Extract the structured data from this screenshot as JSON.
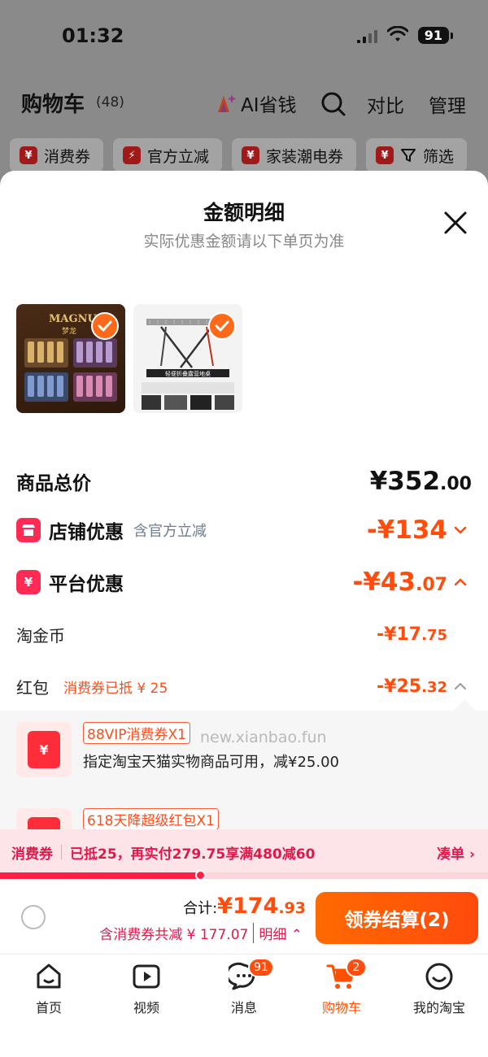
{
  "status": {
    "time": "01:32",
    "battery": "91"
  },
  "cart": {
    "title": "购物车",
    "count": "(48)",
    "ai_label": "AI省钱",
    "compare": "对比",
    "manage": "管理"
  },
  "filters": [
    {
      "label": "消费券",
      "icon": "coupon-icon"
    },
    {
      "label": "官方立减",
      "icon": "flash-icon"
    },
    {
      "label": "家装潮电券",
      "icon": "coupon-icon"
    },
    {
      "label": "筛选",
      "icon": "filter-icon"
    }
  ],
  "sheet": {
    "title": "金额明细",
    "subtitle": "实际优惠金额请以下单页为准",
    "thumb1_brand": "MAGNUM",
    "thumb1_brand_cn": "梦龙",
    "thumb2_caption": "轻便折叠露营地桌"
  },
  "rows": {
    "total_label": "商品总价",
    "total_int": "¥352",
    "total_dec": ".00",
    "shop_label": "店铺优惠",
    "shop_hint": "含官方立减",
    "shop_value": "-¥134",
    "platform_label": "平台优惠",
    "platform_int": "-¥43",
    "platform_dec": ".07",
    "coins_label": "淘金币",
    "coins_int": "-¥17",
    "coins_dec": ".75",
    "redpacket_label": "红包",
    "redpacket_hint": "消费券已抵 ¥ 25",
    "redpacket_int": "-¥25",
    "redpacket_dec": ".32"
  },
  "coupons": [
    {
      "tag": "88VIP消费券X1",
      "desc": "指定淘宝天猫实物商品可用，减¥25.00"
    },
    {
      "tag": "618天降超级红包X1",
      "desc": ""
    }
  ],
  "watermark": "new.xianbao.fun",
  "promo": {
    "tag": "消费券",
    "text": "已抵25，再实付279.75享满480减60",
    "action": "凑单",
    "progress": 0.41
  },
  "checkout": {
    "total_label": "合计:",
    "total_int": "¥174",
    "total_dec": ".93",
    "save_text": "含消费券共减 ¥ 177.07",
    "detail_text": "明细",
    "pay_label": "领券结算(2)"
  },
  "tabs": [
    {
      "label": "首页",
      "icon": "home-icon",
      "active": false
    },
    {
      "label": "视频",
      "icon": "video-icon",
      "active": false
    },
    {
      "label": "消息",
      "icon": "message-icon",
      "badge": "91",
      "active": false
    },
    {
      "label": "购物车",
      "icon": "cart-icon",
      "badge": "2",
      "active": true
    },
    {
      "label": "我的淘宝",
      "icon": "profile-icon",
      "active": false
    }
  ],
  "colors": {
    "accent": "#ff4d0d",
    "promo": "#e0194a",
    "badge": "#ff2b55"
  }
}
